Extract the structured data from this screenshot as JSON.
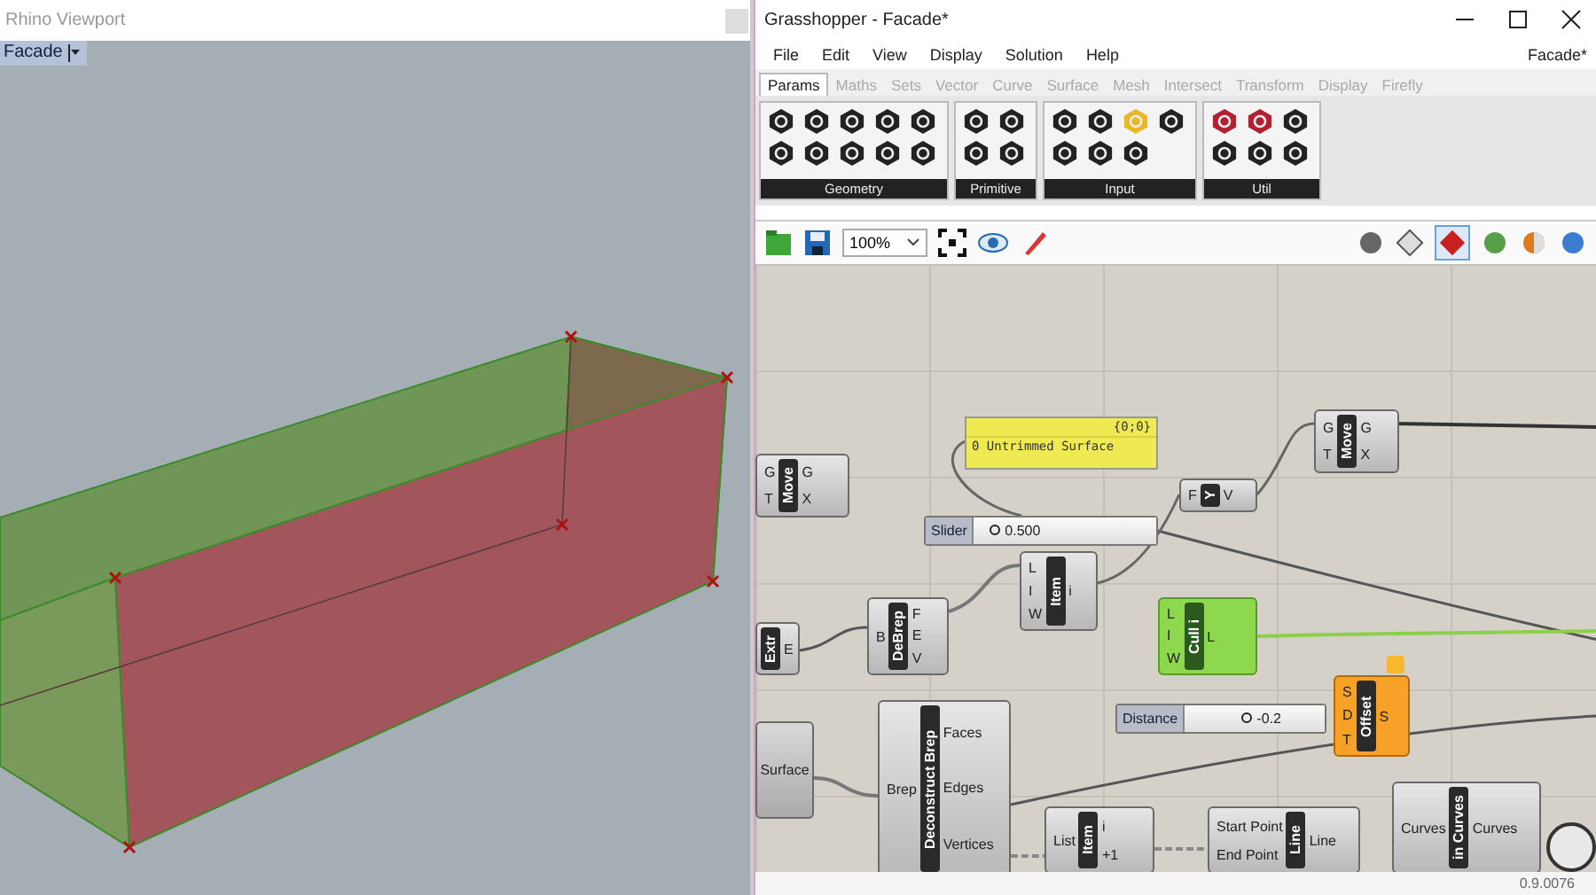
{
  "viewport": {
    "title": "Rhino Viewport",
    "tab": "Facade"
  },
  "window": {
    "title": "Grasshopper - Facade*",
    "document": "Facade*"
  },
  "menu": [
    "File",
    "Edit",
    "View",
    "Display",
    "Solution",
    "Help"
  ],
  "tabs": [
    {
      "label": "Params",
      "selected": true
    },
    {
      "label": "Maths",
      "selected": false
    },
    {
      "label": "Sets",
      "selected": false
    },
    {
      "label": "Vector",
      "selected": false
    },
    {
      "label": "Curve",
      "selected": false
    },
    {
      "label": "Surface",
      "selected": false
    },
    {
      "label": "Mesh",
      "selected": false
    },
    {
      "label": "Intersect",
      "selected": false
    },
    {
      "label": "Transform",
      "selected": false
    },
    {
      "label": "Display",
      "selected": false
    },
    {
      "label": "Firefly",
      "selected": false
    }
  ],
  "palette_groups": [
    "Geometry",
    "Primitive",
    "Input",
    "Util"
  ],
  "toolbar": {
    "zoom": "100%"
  },
  "canvas": {
    "panel": {
      "header": "{0;0}",
      "text": "0 Untrimmed Surface"
    },
    "sliders": [
      {
        "label": "Slider",
        "value": "0.500",
        "level": 0.08
      },
      {
        "label": "Distance",
        "value": "-0.2",
        "level": 0.4
      }
    ],
    "nodes": [
      {
        "name": "Move",
        "kind": "normal",
        "inputs": [
          "G",
          "T"
        ],
        "outputs": [
          "G",
          "X"
        ]
      },
      {
        "name": "Move",
        "kind": "normal",
        "inputs": [
          "G",
          "T"
        ],
        "outputs": [
          "G",
          "X"
        ]
      },
      {
        "name": "Y",
        "kind": "normal",
        "inputs": [
          "F"
        ],
        "outputs": [
          "V"
        ]
      },
      {
        "name": "Item",
        "kind": "normal",
        "inputs": [
          "L",
          "I",
          "W"
        ],
        "outputs": [
          "i"
        ]
      },
      {
        "name": "Extr",
        "kind": "normal",
        "outputs": [
          "E"
        ]
      },
      {
        "name": "DeBrep",
        "kind": "normal",
        "inputs": [
          "B"
        ],
        "outputs": [
          "F",
          "E",
          "V"
        ]
      },
      {
        "name": "Cull i",
        "kind": "selected",
        "inputs": [
          "L",
          "I",
          "W"
        ],
        "outputs": [
          "L"
        ]
      },
      {
        "name": "Offset",
        "kind": "warning",
        "inputs": [
          "S",
          "D",
          "T"
        ],
        "outputs": [
          "S"
        ]
      },
      {
        "name": "Surface",
        "kind": "param"
      },
      {
        "name": "Deconstruct Brep",
        "kind": "normal",
        "inputs": [
          "Brep"
        ],
        "outputs": [
          "Faces",
          "Edges",
          "Vertices"
        ]
      },
      {
        "name": "Item",
        "kind": "normal",
        "inputs": [
          "List"
        ],
        "outputs": [
          "i",
          "+1"
        ]
      },
      {
        "name": "Line",
        "kind": "normal",
        "inputs": [
          "Start Point",
          "End Point"
        ],
        "outputs": [
          "Line"
        ]
      },
      {
        "name": "in Curves",
        "kind": "normal",
        "inputs": [
          "Curves"
        ],
        "outputs": [
          "Curves"
        ]
      }
    ]
  },
  "status_bar": "0.9.0076"
}
